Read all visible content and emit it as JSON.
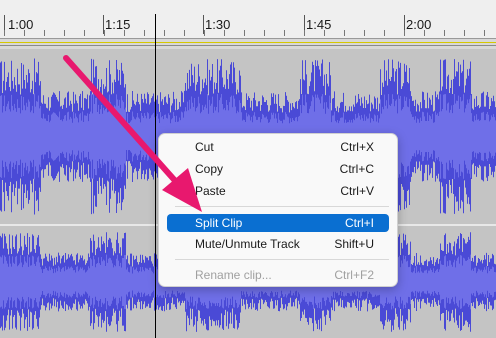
{
  "timeline": {
    "labels": [
      "1:00",
      "1:15",
      "1:30",
      "1:45",
      "2:00"
    ]
  },
  "context_menu": {
    "items": [
      {
        "label": "Cut",
        "shortcut": "Ctrl+X",
        "state": "normal"
      },
      {
        "label": "Copy",
        "shortcut": "Ctrl+C",
        "state": "normal"
      },
      {
        "label": "Paste",
        "shortcut": "Ctrl+V",
        "state": "normal"
      },
      {
        "label": "Split Clip",
        "shortcut": "Ctrl+I",
        "state": "highlighted"
      },
      {
        "label": "Mute/Unmute Track",
        "shortcut": "Shift+U",
        "state": "normal"
      },
      {
        "label": "Rename clip...",
        "shortcut": "Ctrl+F2",
        "state": "disabled"
      }
    ]
  },
  "colors": {
    "waveform": "#4a4ad6",
    "waveform_rms": "#6f6fe8",
    "highlight": "#0a6fd1",
    "annotation_arrow": "#e8186e"
  },
  "icons": [
    "annotation-arrow"
  ]
}
